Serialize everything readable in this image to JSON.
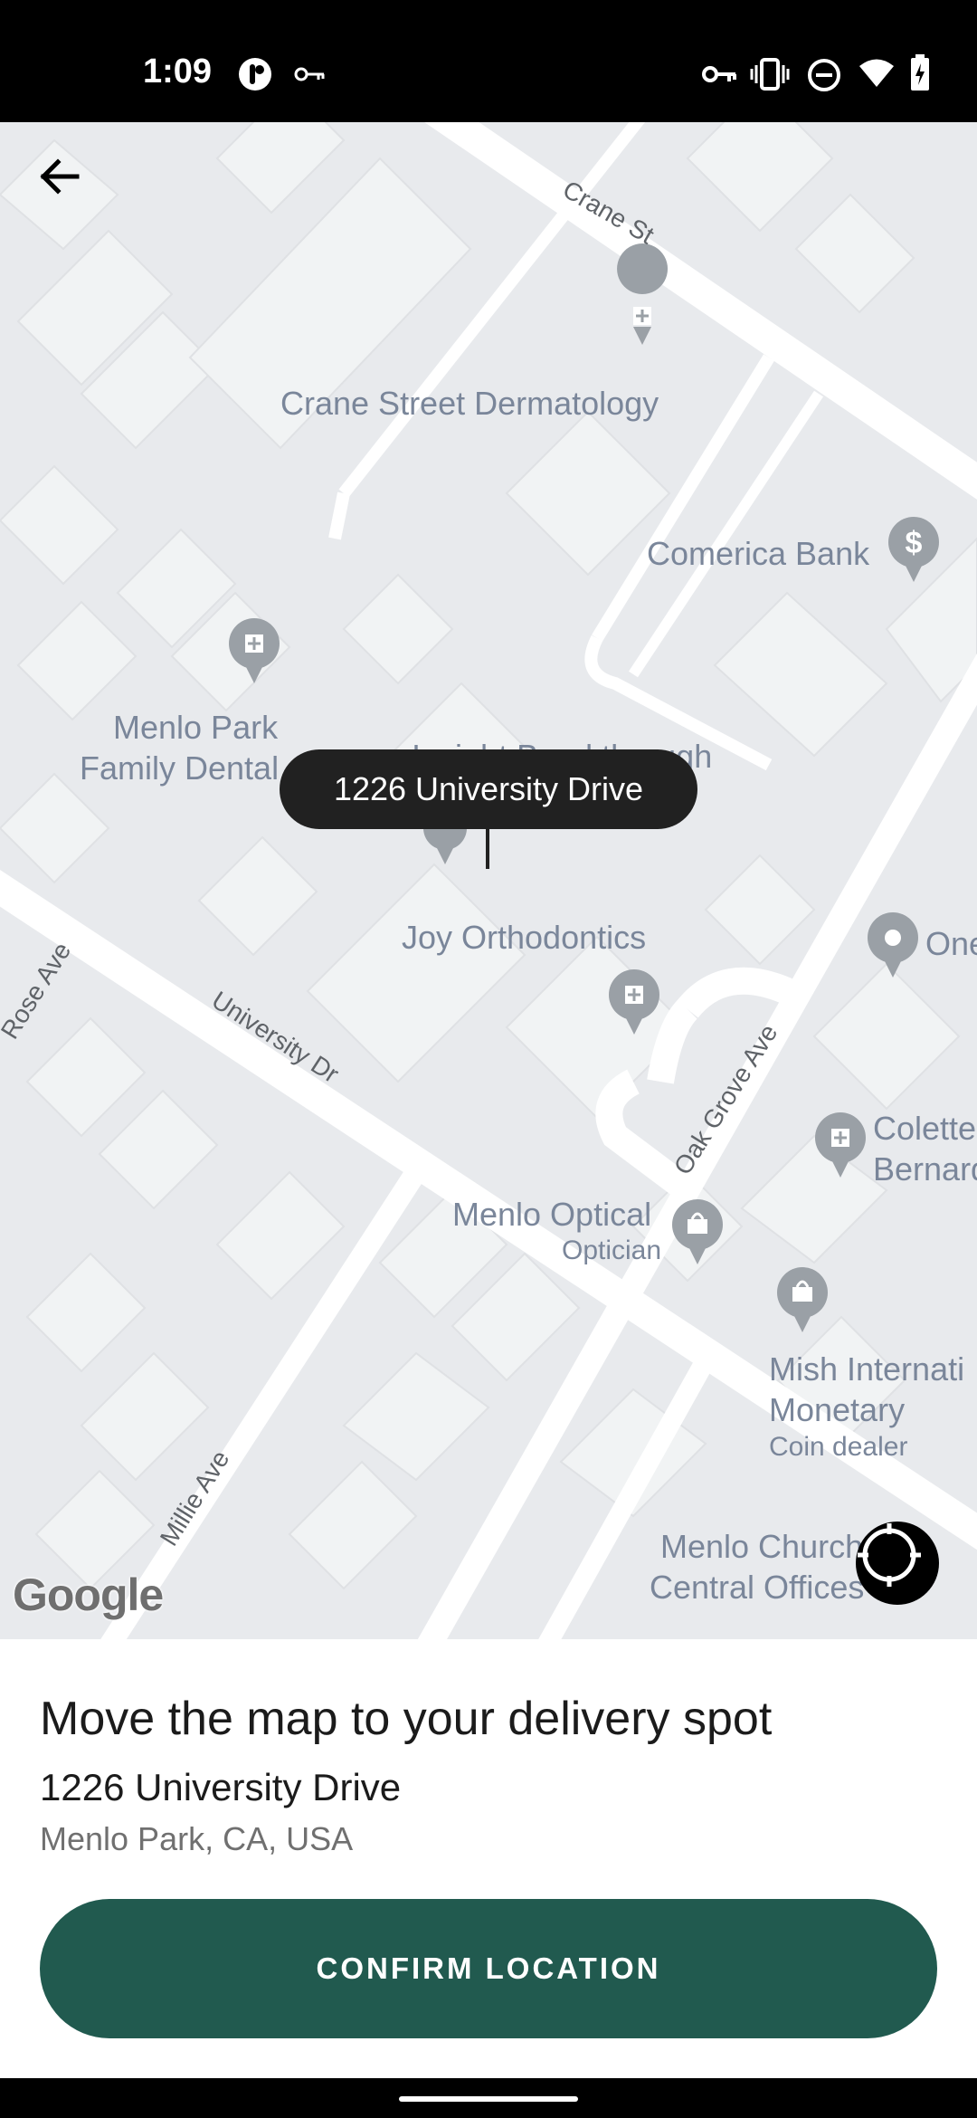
{
  "status_bar": {
    "time": "1:09",
    "icons": [
      "app-icon",
      "key-icon",
      "vpn-key-icon",
      "vibrate-icon",
      "do-not-disturb-icon",
      "wifi-icon",
      "battery-charging-icon"
    ]
  },
  "map": {
    "streets": [
      "Crane St",
      "University Dr",
      "Oak Grove Ave",
      "Rose Ave",
      "Millie Ave"
    ],
    "places": [
      {
        "name": "Crane Street Dermatology",
        "icon": "medical-icon"
      },
      {
        "name": "Comerica Bank",
        "icon": "bank-icon"
      },
      {
        "name": "Menlo Park",
        "icon": "medical-icon"
      },
      {
        "name": "Family Dental"
      },
      {
        "name": "Insight Breakthrough"
      },
      {
        "name": "Joy Orthodontics",
        "icon": "medical-icon"
      },
      {
        "name": "One",
        "icon": "place-icon"
      },
      {
        "name": "Colette",
        "icon": "medical-icon"
      },
      {
        "name": "Bernard"
      },
      {
        "name": "Menlo Optical",
        "sub": "Optician",
        "icon": "shopping-icon"
      },
      {
        "name": "Mish Internati",
        "icon": "shopping-icon"
      },
      {
        "name": "Monetary",
        "sub": "Coin dealer"
      },
      {
        "name": "Menlo Church"
      },
      {
        "name": "Central Offices"
      }
    ],
    "pin_label": "1226 University Drive",
    "attribution": "Google"
  },
  "sheet": {
    "title": "Move the map to your delivery spot",
    "address_line1": "1226 University Drive",
    "address_line2": "Menlo Park, CA, USA",
    "confirm_label": "CONFIRM LOCATION"
  },
  "colors": {
    "accent": "#215a4f",
    "map_background": "#e8eaed",
    "road": "#ffffff",
    "building": "#f1f3f4",
    "poi_label": "#7a869a",
    "poi_marker": "#9aa0a6",
    "pin_label_bg": "#212121"
  }
}
